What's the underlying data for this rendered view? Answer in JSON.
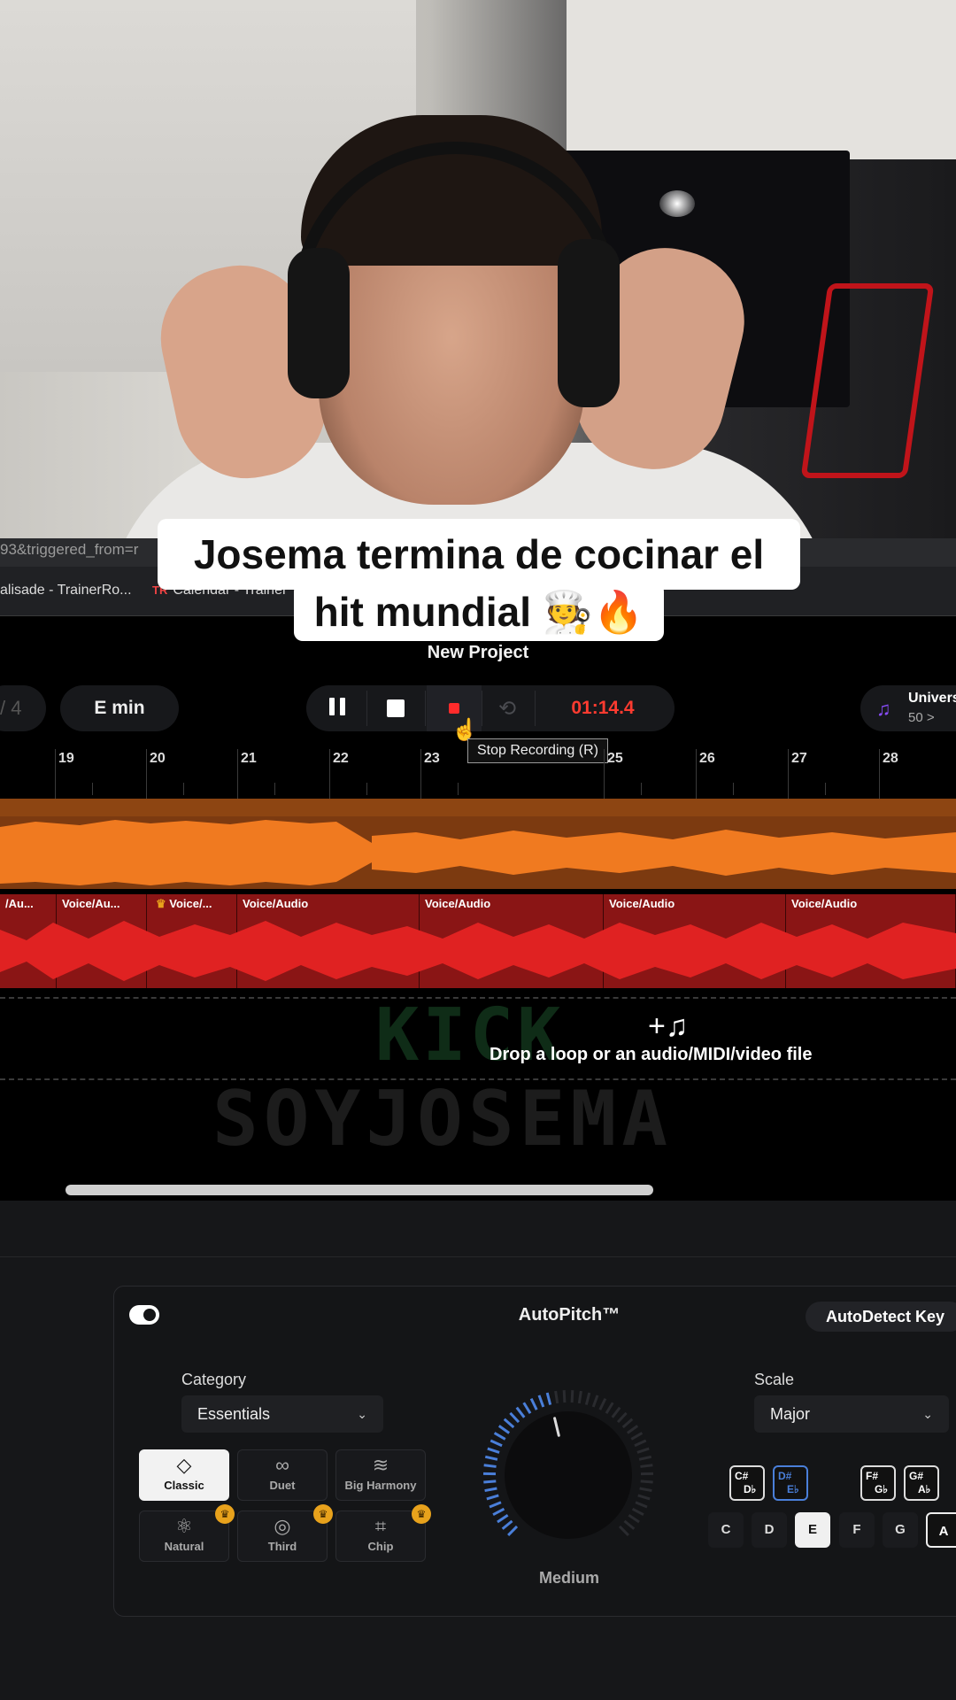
{
  "caption": {
    "line1": "Josema termina de cocinar el",
    "line2": "hit mundial 🧑‍🍳🔥"
  },
  "browser": {
    "url_fragment": "93&triggered_from=r",
    "bookmarks": [
      "alisade - TrainerRo...",
      "Calendar - Trainer"
    ]
  },
  "daw": {
    "project_title": "New Project",
    "time_signature_partial": "/ 4",
    "key": "E min",
    "timer": "01:14.4",
    "tooltip": "Stop Recording (R)",
    "universal": {
      "title": "Univers",
      "sub": "50 >"
    },
    "ruler": [
      "19",
      "20",
      "21",
      "22",
      "23",
      "25",
      "26",
      "27",
      "28"
    ],
    "clips": [
      "/Au...",
      "Voice/Au...",
      "Voice/...",
      "Voice/Audio",
      "Voice/Audio",
      "Voice/Audio",
      "Voice/Audio"
    ],
    "drop_text": "Drop a loop or an audio/MIDI/video file",
    "watermarks": {
      "kick": "KICK",
      "name": "SOYJOSEMA"
    }
  },
  "autopitch": {
    "title": "AutoPitch™",
    "autodetect_label": "AutoDetect Key",
    "category_label": "Category",
    "category_value": "Essentials",
    "scale_label": "Scale",
    "scale_value": "Major",
    "modes": [
      {
        "label": "Classic",
        "icon": "diamond-icon",
        "active": true
      },
      {
        "label": "Duet",
        "icon": "duet-icon"
      },
      {
        "label": "Big Harmony",
        "icon": "harmony-icon"
      },
      {
        "label": "Natural",
        "icon": "atom-icon",
        "premium": true
      },
      {
        "label": "Third",
        "icon": "third-icon",
        "premium": true
      },
      {
        "label": "Chip",
        "icon": "chip-icon",
        "premium": true
      }
    ],
    "knob_label": "Medium",
    "knob_level": 0.45,
    "black_keys": [
      {
        "top": "C#",
        "bottom": "D♭"
      },
      {
        "top": "D#",
        "bottom": "E♭",
        "selected": true
      },
      {
        "top": "F#",
        "bottom": "G♭"
      },
      {
        "top": "G#",
        "bottom": "A♭"
      }
    ],
    "white_keys": [
      "C",
      "D",
      "E",
      "F",
      "G",
      "A"
    ],
    "selected_key": "E",
    "colors": {
      "accent_blue": "#4a7fd9",
      "record_red": "#ff3b30",
      "track_orange": "#f07a20",
      "track_red": "#e02222"
    }
  }
}
